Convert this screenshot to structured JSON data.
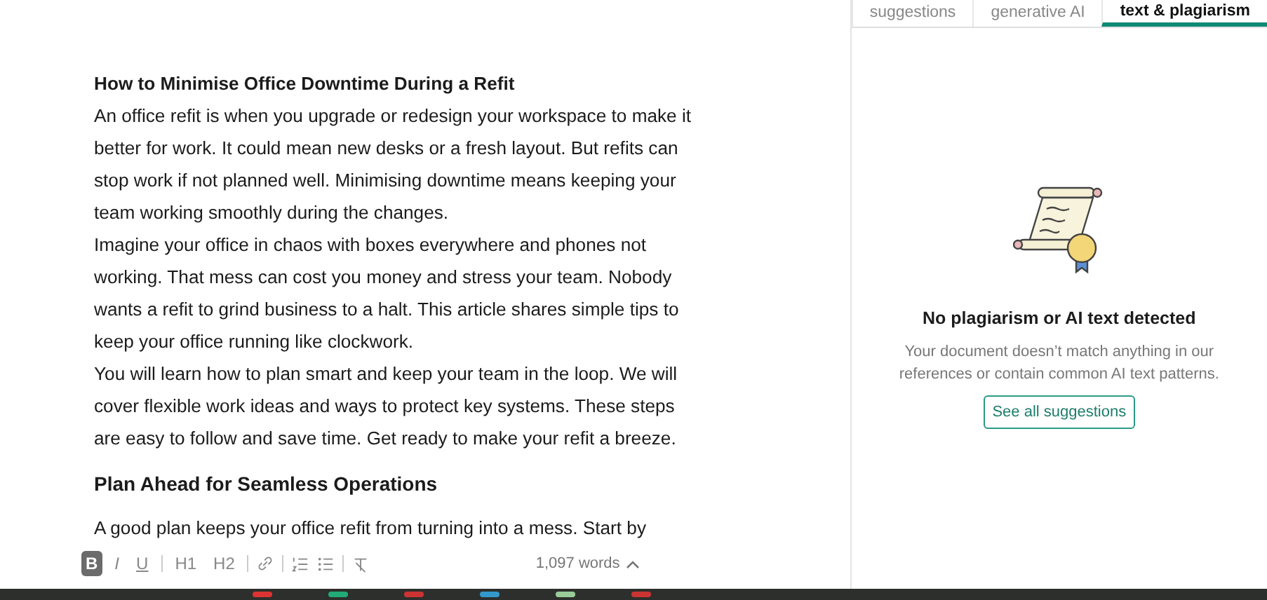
{
  "document": {
    "blocks": [
      {
        "kind": "heading",
        "text": "How to Minimise Office Downtime During a Refit"
      },
      {
        "kind": "paragraph",
        "text": "An office refit is when you upgrade or redesign your workspace to make it better for work. It could mean new desks or a fresh layout. But refits can stop work if not planned well. Minimising downtime means keeping your team working smoothly during the changes."
      },
      {
        "kind": "paragraph",
        "text": "Imagine your office in chaos with boxes everywhere and phones not working. That mess can cost you money and stress your team. Nobody wants a refit to grind business to a halt. This article shares simple tips to keep your office running like clockwork."
      },
      {
        "kind": "paragraph",
        "text": "You will learn how to plan smart and keep your team in the loop. We will cover flexible work ideas and ways to protect key systems. These steps are easy to follow and save time. Get ready to make your refit a breeze."
      },
      {
        "kind": "subheading",
        "text": "Plan Ahead for Seamless Operations"
      },
      {
        "kind": "paragraph",
        "text": "A good plan keeps your office refit from turning into a mess. Start by"
      }
    ]
  },
  "toolbar": {
    "items": [
      {
        "kind": "bold",
        "text": "B",
        "selected": true
      },
      {
        "kind": "italic",
        "text": "I",
        "selected": false
      },
      {
        "kind": "underline",
        "text": "U",
        "selected": false
      },
      {
        "kind": "divider"
      },
      {
        "kind": "heading",
        "text": "H1",
        "selected": false
      },
      {
        "kind": "heading",
        "text": "H2",
        "selected": false
      },
      {
        "kind": "divider"
      },
      {
        "kind": "link",
        "selected": false
      },
      {
        "kind": "divider"
      },
      {
        "kind": "numbered",
        "selected": false
      },
      {
        "kind": "bullets",
        "selected": false
      },
      {
        "kind": "divider"
      },
      {
        "kind": "clear",
        "selected": false
      }
    ],
    "word_count": "1,097 words"
  },
  "panel": {
    "tabs": [
      {
        "label": "suggestions",
        "selected": false
      },
      {
        "label": "generative AI",
        "selected": false
      },
      {
        "label": "text & plagiarism",
        "selected": true
      }
    ],
    "title": "No plagiarism or AI text detected",
    "message": "Your document doesn’t match anything in our references or contain common AI text patterns.",
    "button": "See all suggestions"
  }
}
